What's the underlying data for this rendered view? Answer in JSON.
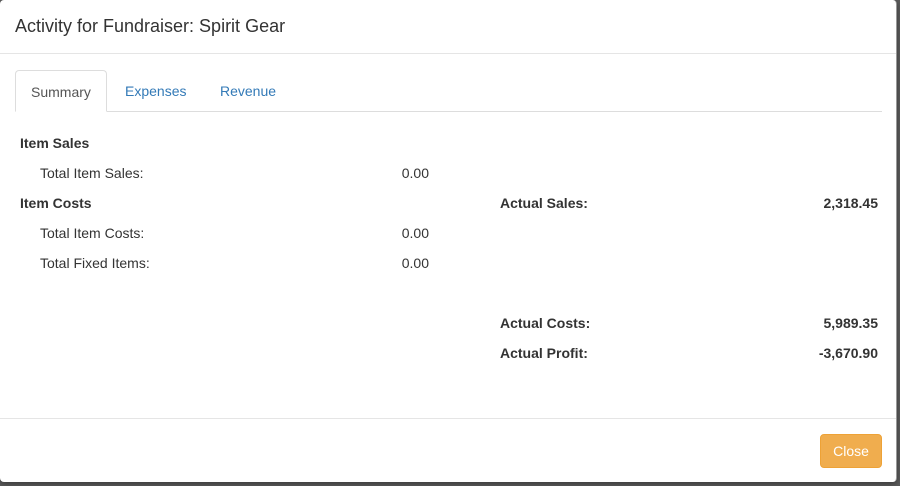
{
  "modal": {
    "title": "Activity for Fundraiser: Spirit Gear"
  },
  "tabs": [
    {
      "label": "Summary",
      "active": true
    },
    {
      "label": "Expenses",
      "active": false
    },
    {
      "label": "Revenue",
      "active": false
    }
  ],
  "summary": {
    "item_sales": {
      "heading": "Item Sales",
      "total_item_sales_label": "Total Item Sales:",
      "total_item_sales_value": "0.00"
    },
    "item_costs": {
      "heading": "Item Costs",
      "total_item_costs_label": "Total Item Costs:",
      "total_item_costs_value": "0.00",
      "total_fixed_items_label": "Total Fixed Items:",
      "total_fixed_items_value": "0.00"
    },
    "actual_sales_label": "Actual Sales:",
    "actual_sales_value": "2,318.45",
    "actual_costs_label": "Actual Costs:",
    "actual_costs_value": "5,989.35",
    "actual_profit_label": "Actual Profit:",
    "actual_profit_value": "-3,670.90"
  },
  "footer": {
    "close_label": "Close"
  },
  "colors": {
    "link": "#337ab7",
    "close_button": "#f0ad4e"
  }
}
